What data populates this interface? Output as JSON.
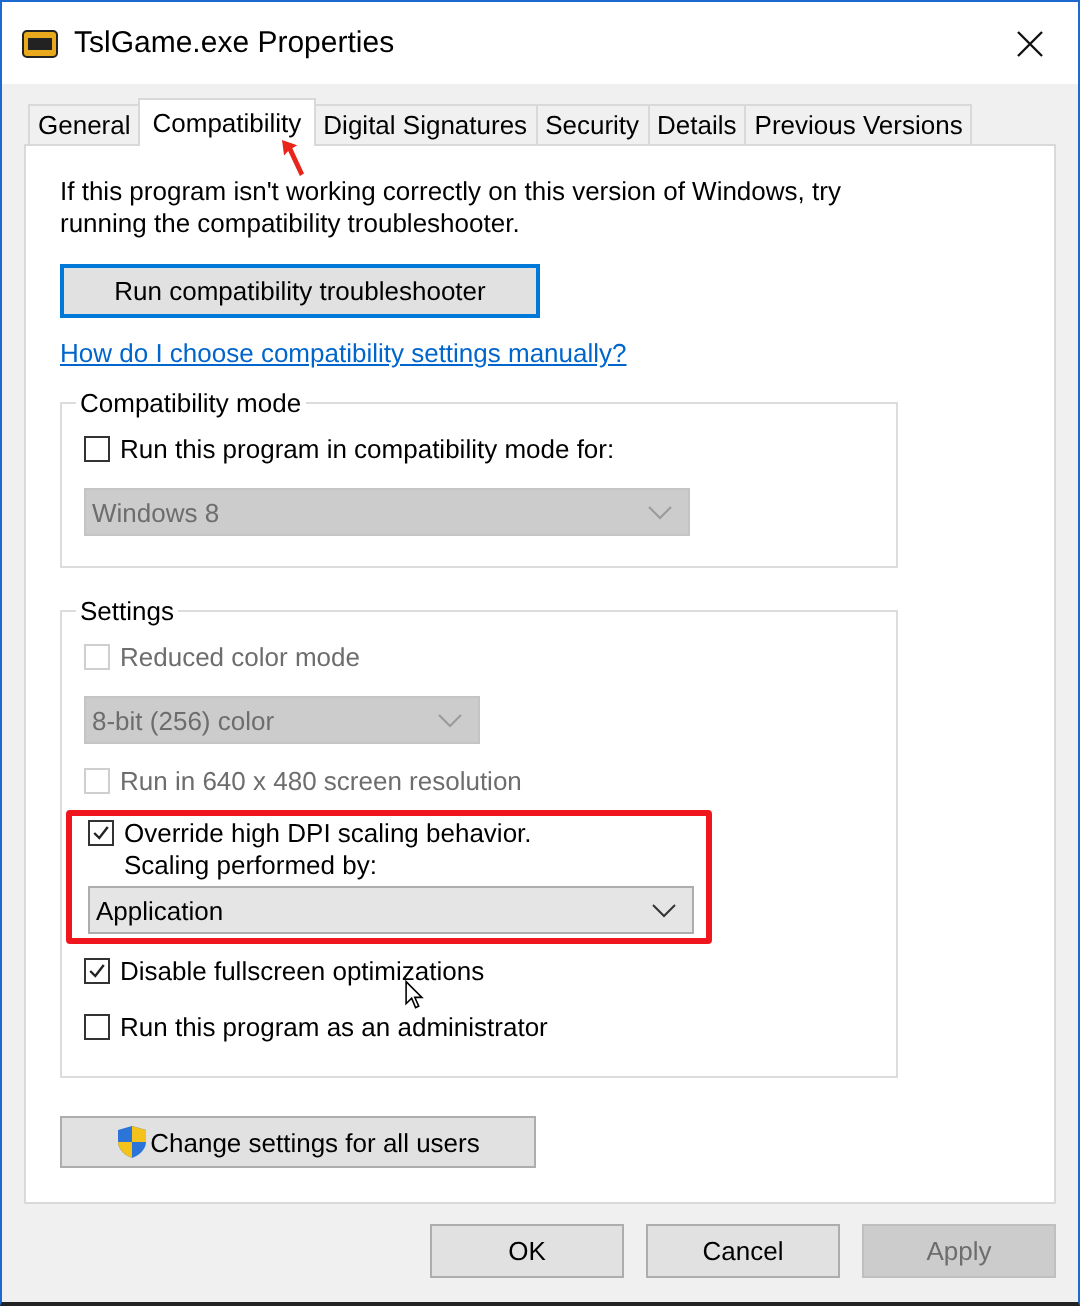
{
  "window": {
    "title": "TslGame.exe Properties"
  },
  "tabs": [
    {
      "label": "General",
      "selected": false
    },
    {
      "label": "Compatibility",
      "selected": true
    },
    {
      "label": "Digital Signatures",
      "selected": false
    },
    {
      "label": "Security",
      "selected": false
    },
    {
      "label": "Details",
      "selected": false
    },
    {
      "label": "Previous Versions",
      "selected": false
    }
  ],
  "intro": "If this program isn't working correctly on this version of Windows, try running the compatibility troubleshooter.",
  "troubleshoot_button": "Run compatibility troubleshooter",
  "help_link": "How do I choose compatibility settings manually?",
  "groups": [
    {
      "title": "Compatibility mode",
      "items": [
        {
          "kind": "checkbox",
          "label": "Run this program in compatibility mode for:",
          "checked": false,
          "disabled": false
        },
        {
          "kind": "dropdown",
          "value": "Windows 8",
          "disabled": true,
          "wide": true
        }
      ]
    },
    {
      "title": "Settings",
      "items": [
        {
          "kind": "checkbox",
          "label": "Reduced color mode",
          "checked": false,
          "disabled": true
        },
        {
          "kind": "dropdown",
          "value": "8-bit (256) color",
          "disabled": true,
          "wide": false
        },
        {
          "kind": "checkbox",
          "label": "Run in 640 x 480 screen resolution",
          "checked": false,
          "disabled": true
        },
        {
          "kind": "highlight",
          "highlighted": true,
          "items": [
            {
              "kind": "checkbox",
              "label": "Override high DPI scaling behavior.\nScaling performed by:",
              "checked": true,
              "disabled": false
            },
            {
              "kind": "dropdown",
              "value": "Application",
              "disabled": false,
              "wide": true
            }
          ]
        },
        {
          "kind": "checkbox",
          "label": "Disable fullscreen optimizations",
          "checked": true,
          "disabled": false
        },
        {
          "kind": "checkbox",
          "label": "Run this program as an administrator",
          "checked": false,
          "disabled": false
        }
      ]
    }
  ],
  "all_users_button": "Change settings for all users",
  "buttons": [
    {
      "label": "OK",
      "disabled": false
    },
    {
      "label": "Cancel",
      "disabled": false
    },
    {
      "label": "Apply",
      "disabled": true
    }
  ]
}
